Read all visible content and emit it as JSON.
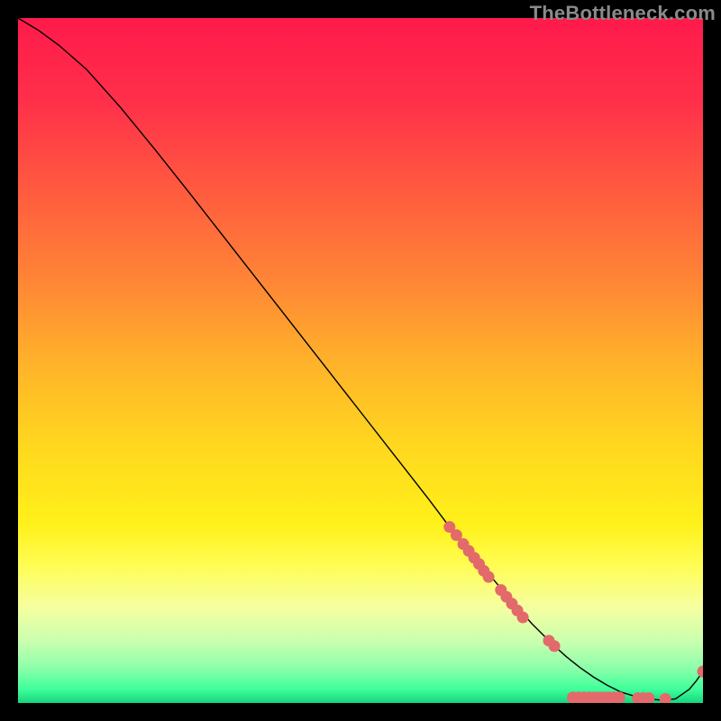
{
  "watermark": "TheBottleneck.com",
  "chart_data": {
    "type": "line",
    "title": "",
    "xlabel": "",
    "ylabel": "",
    "xlim": [
      0,
      100
    ],
    "ylim": [
      0,
      100
    ],
    "grid": false,
    "background_gradient": {
      "stops": [
        {
          "pos": 0.0,
          "color": "#ff1a4b"
        },
        {
          "pos": 0.12,
          "color": "#ff2f4a"
        },
        {
          "pos": 0.25,
          "color": "#ff5a3f"
        },
        {
          "pos": 0.38,
          "color": "#ff8436"
        },
        {
          "pos": 0.5,
          "color": "#ffb12a"
        },
        {
          "pos": 0.62,
          "color": "#ffd61f"
        },
        {
          "pos": 0.74,
          "color": "#fff11a"
        },
        {
          "pos": 0.8,
          "color": "#fffd55"
        },
        {
          "pos": 0.86,
          "color": "#f6ffa0"
        },
        {
          "pos": 0.91,
          "color": "#c9ffaf"
        },
        {
          "pos": 0.95,
          "color": "#8affaa"
        },
        {
          "pos": 0.98,
          "color": "#3eff9a"
        },
        {
          "pos": 1.0,
          "color": "#17d47e"
        }
      ]
    },
    "series": [
      {
        "name": "bottleneck-curve",
        "color": "#000000",
        "width": 1.4,
        "x": [
          0,
          3,
          6,
          10,
          15,
          20,
          25,
          30,
          35,
          40,
          45,
          50,
          55,
          60,
          63,
          66,
          69,
          72,
          75,
          78,
          80,
          82,
          84,
          86,
          88,
          90,
          92,
          94,
          96,
          98,
          99,
          100
        ],
        "y": [
          100,
          98.2,
          96.0,
          92.5,
          86.9,
          80.8,
          74.5,
          68.1,
          61.7,
          55.3,
          48.9,
          42.5,
          36.1,
          29.7,
          25.7,
          22.0,
          18.5,
          15.0,
          11.6,
          8.6,
          6.8,
          5.2,
          3.8,
          2.6,
          1.6,
          1.0,
          0.6,
          0.4,
          0.6,
          2.0,
          3.2,
          4.6
        ]
      }
    ],
    "markers": {
      "name": "highlight-dots",
      "color": "#e26a6a",
      "radius": 6.5,
      "clusters": [
        {
          "x": [
            63.0,
            64.0,
            65.0,
            65.8,
            66.6,
            67.3,
            68.0,
            68.7
          ],
          "y": [
            25.7,
            24.5,
            23.2,
            22.2,
            21.2,
            20.3,
            19.3,
            18.4
          ]
        },
        {
          "x": [
            70.5,
            71.3,
            72.1,
            72.9,
            73.7
          ],
          "y": [
            16.5,
            15.5,
            14.5,
            13.5,
            12.5
          ]
        },
        {
          "x": [
            77.5,
            78.3
          ],
          "y": [
            9.1,
            8.3
          ]
        },
        {
          "x": [
            81.0,
            81.8,
            82.6,
            83.4,
            84.1,
            84.8,
            85.5,
            86.2,
            87.0,
            87.8
          ],
          "y": [
            0.8,
            0.8,
            0.8,
            0.8,
            0.8,
            0.8,
            0.8,
            0.8,
            0.8,
            0.8
          ]
        },
        {
          "x": [
            90.5,
            91.3,
            92.1
          ],
          "y": [
            0.7,
            0.7,
            0.7
          ]
        },
        {
          "x": [
            94.5
          ],
          "y": [
            0.6
          ]
        },
        {
          "x": [
            100.0
          ],
          "y": [
            4.6
          ]
        }
      ]
    }
  }
}
